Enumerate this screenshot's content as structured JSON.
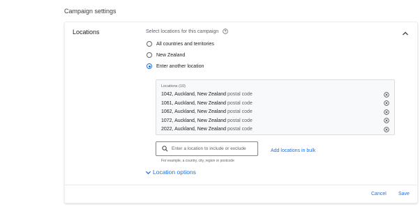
{
  "header": {
    "title": "Campaign settings"
  },
  "section": {
    "label": "Locations",
    "subtitle": "Select locations for this campaign"
  },
  "radio_options": [
    {
      "label": "All countries and territories",
      "selected": false
    },
    {
      "label": "New Zealand",
      "selected": false
    },
    {
      "label": "Enter another location",
      "selected": true
    }
  ],
  "locations": {
    "header": "Locations (10)",
    "items": [
      {
        "name": "1042, Auckland, New Zealand",
        "type": "postal code"
      },
      {
        "name": "1061, Auckland, New Zealand",
        "type": "postal code"
      },
      {
        "name": "1062, Auckland, New Zealand",
        "type": "postal code"
      },
      {
        "name": "1072, Auckland, New Zealand",
        "type": "postal code"
      },
      {
        "name": "2022, Auckland, New Zealand",
        "type": "postal code"
      }
    ]
  },
  "search": {
    "placeholder": "Enter a location to include or exclude",
    "value": "",
    "hint": "For example, a country, city, region or postcode"
  },
  "bulk_link": "Add locations in bulk",
  "location_options_label": "Location options",
  "footer": {
    "cancel": "Cancel",
    "save": "Save"
  },
  "colors": {
    "accent": "#1a73e8",
    "text": "#202124",
    "muted": "#5f6368"
  }
}
